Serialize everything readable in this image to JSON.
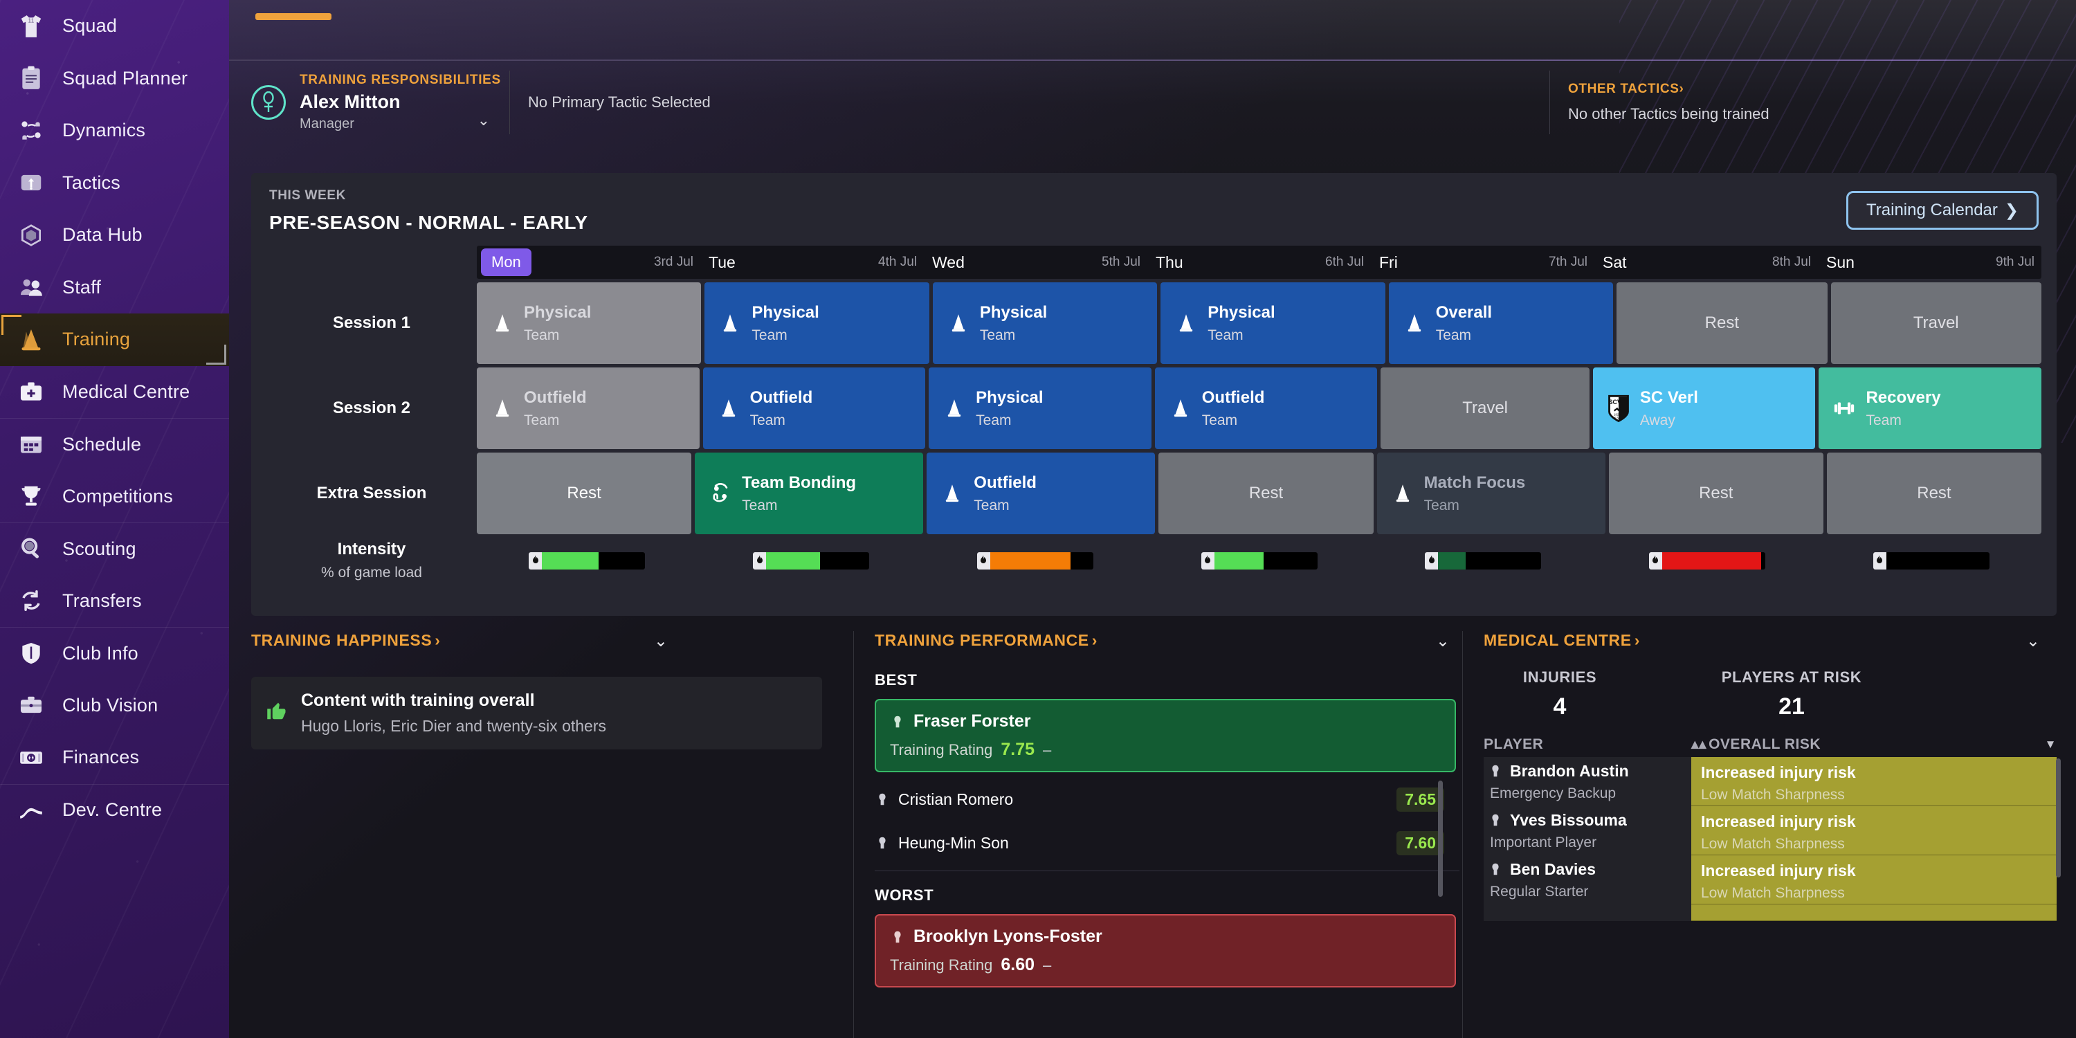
{
  "sidebar": {
    "items": [
      {
        "label": "Squad",
        "icon": "shirt-icon",
        "active": false,
        "sep": false
      },
      {
        "label": "Squad Planner",
        "icon": "clipboard-icon",
        "active": false,
        "sep": false
      },
      {
        "label": "Dynamics",
        "icon": "dynamics-icon",
        "active": false,
        "sep": false
      },
      {
        "label": "Tactics",
        "icon": "tactics-icon",
        "active": false,
        "sep": false
      },
      {
        "label": "Data Hub",
        "icon": "datahub-icon",
        "active": false,
        "sep": false
      },
      {
        "label": "Staff",
        "icon": "staff-icon",
        "active": false,
        "sep": false
      },
      {
        "label": "Training",
        "icon": "cone-icon",
        "active": true,
        "sep": false
      },
      {
        "label": "Medical Centre",
        "icon": "medkit-icon",
        "active": false,
        "sep": false
      },
      {
        "label": "Schedule",
        "icon": "calendar-icon",
        "active": false,
        "sep": true
      },
      {
        "label": "Competitions",
        "icon": "trophy-icon",
        "active": false,
        "sep": false
      },
      {
        "label": "Scouting",
        "icon": "magnifier-icon",
        "active": false,
        "sep": true
      },
      {
        "label": "Transfers",
        "icon": "transfer-arrows-icon",
        "active": false,
        "sep": false
      },
      {
        "label": "Club Info",
        "icon": "shield-icon",
        "active": false,
        "sep": true
      },
      {
        "label": "Club Vision",
        "icon": "briefcase-icon",
        "active": false,
        "sep": false
      },
      {
        "label": "Finances",
        "icon": "banknote-icon",
        "active": false,
        "sep": false
      },
      {
        "label": "Dev. Centre",
        "icon": "growth-curve-icon",
        "active": false,
        "sep": true
      }
    ]
  },
  "responsibilities": {
    "label": "TRAINING RESPONSIBILITIES",
    "name": "Alex Mitton",
    "role": "Manager",
    "primary_tactic": "No Primary Tactic Selected",
    "other_tactics_label": "OTHER TACTICS",
    "other_tactics_value": "No other Tactics being trained"
  },
  "schedule": {
    "week_label": "THIS WEEK",
    "week_title": "PRE-SEASON - NORMAL - EARLY",
    "calendar_button": "Training Calendar",
    "days": [
      {
        "name": "Mon",
        "date": "3rd Jul",
        "today": true
      },
      {
        "name": "Tue",
        "date": "4th Jul",
        "today": false
      },
      {
        "name": "Wed",
        "date": "5th Jul",
        "today": false
      },
      {
        "name": "Thu",
        "date": "6th Jul",
        "today": false
      },
      {
        "name": "Fri",
        "date": "7th Jul",
        "today": false
      },
      {
        "name": "Sat",
        "date": "8th Jul",
        "today": false
      },
      {
        "name": "Sun",
        "date": "9th Jul",
        "today": false
      }
    ],
    "rows": [
      {
        "label": "Session 1",
        "cells": [
          {
            "title": "Physical",
            "sub": "Team",
            "style": "c-grey",
            "icon": "cone-icon",
            "center": false
          },
          {
            "title": "Physical",
            "sub": "Team",
            "style": "c-blue",
            "icon": "cone-icon",
            "center": false
          },
          {
            "title": "Physical",
            "sub": "Team",
            "style": "c-blue",
            "icon": "cone-icon",
            "center": false
          },
          {
            "title": "Physical",
            "sub": "Team",
            "style": "c-blue",
            "icon": "cone-icon",
            "center": false
          },
          {
            "title": "Overall",
            "sub": "Team",
            "style": "c-blue",
            "icon": "cone-icon",
            "center": false
          },
          {
            "title": "Rest",
            "sub": "",
            "style": "c-greym",
            "icon": "none",
            "center": true
          },
          {
            "title": "Travel",
            "sub": "",
            "style": "c-greym",
            "icon": "none",
            "center": true
          }
        ]
      },
      {
        "label": "Session 2",
        "cells": [
          {
            "title": "Outfield",
            "sub": "Team",
            "style": "c-grey",
            "icon": "cone-icon",
            "center": false
          },
          {
            "title": "Outfield",
            "sub": "Team",
            "style": "c-blue",
            "icon": "cone-icon",
            "center": false
          },
          {
            "title": "Physical",
            "sub": "Team",
            "style": "c-blue",
            "icon": "cone-icon",
            "center": false
          },
          {
            "title": "Outfield",
            "sub": "Team",
            "style": "c-blue",
            "icon": "cone-icon",
            "center": false
          },
          {
            "title": "Travel",
            "sub": "",
            "style": "c-greym",
            "icon": "none",
            "center": true
          },
          {
            "title": "SC Verl",
            "sub": "Away",
            "style": "c-cyan",
            "icon": "scv-badge-icon",
            "center": false
          },
          {
            "title": "Recovery",
            "sub": "Team",
            "style": "c-teal",
            "icon": "dumbbell-icon",
            "center": false
          }
        ]
      },
      {
        "label": "Extra Session",
        "cells": [
          {
            "title": "Rest",
            "sub": "",
            "style": "c-greyd",
            "icon": "none",
            "center": true
          },
          {
            "title": "Team Bonding",
            "sub": "Team",
            "style": "c-green",
            "icon": "bonding-icon",
            "center": false
          },
          {
            "title": "Outfield",
            "sub": "Team",
            "style": "c-blue",
            "icon": "cone-icon",
            "center": false
          },
          {
            "title": "Rest",
            "sub": "",
            "style": "c-greym",
            "icon": "none",
            "center": true
          },
          {
            "title": "Match Focus",
            "sub": "Team",
            "style": "c-dark",
            "icon": "cone-icon",
            "center": false
          },
          {
            "title": "Rest",
            "sub": "",
            "style": "c-greym",
            "icon": "none",
            "center": true
          },
          {
            "title": "Rest",
            "sub": "",
            "style": "c-greym",
            "icon": "none",
            "center": true
          }
        ]
      }
    ],
    "intensity": {
      "label_1": "Intensity",
      "label_2": "% of game load",
      "bars": [
        {
          "pct": 55,
          "color": "#55dd55"
        },
        {
          "pct": 52,
          "color": "#55dd55"
        },
        {
          "pct": 78,
          "color": "#f57c06"
        },
        {
          "pct": 48,
          "color": "#55dd55"
        },
        {
          "pct": 27,
          "color": "#17683a"
        },
        {
          "pct": 96,
          "color": "#e31616"
        },
        {
          "pct": 0,
          "color": "#000000"
        }
      ]
    }
  },
  "training_happiness": {
    "title": "TRAINING HAPPINESS",
    "headline": "Content with training overall",
    "detail": "Hugo Lloris, Eric Dier and twenty-six others"
  },
  "training_performance": {
    "title": "TRAINING PERFORMANCE",
    "best_label": "BEST",
    "worst_label": "WORST",
    "rating_label": "Training Rating",
    "best": {
      "name": "Fraser Forster",
      "rating": "7.75",
      "trend": "–"
    },
    "others": [
      {
        "name": "Cristian Romero",
        "rating": "7.65"
      },
      {
        "name": "Heung-Min Son",
        "rating": "7.60"
      }
    ],
    "worst": {
      "name": "Brooklyn Lyons-Foster",
      "rating": "6.60",
      "trend": "–"
    }
  },
  "medical_centre": {
    "title": "MEDICAL CENTRE",
    "stats": [
      {
        "label": "INJURIES",
        "value": "4"
      },
      {
        "label": "PLAYERS AT RISK",
        "value": "21"
      }
    ],
    "columns": {
      "player": "PLAYER",
      "risk": "OVERALL RISK"
    },
    "rows": [
      {
        "name": "Brandon Austin",
        "role": "Emergency Backup",
        "risk": "Increased injury risk",
        "reason": "Low Match Sharpness"
      },
      {
        "name": "Yves Bissouma",
        "role": "Important Player",
        "risk": "Increased injury risk",
        "reason": "Low Match Sharpness"
      },
      {
        "name": "Ben Davies",
        "role": "Regular Starter",
        "risk": "Increased injury risk",
        "reason": "Low Match Sharpness"
      }
    ]
  },
  "colors": {
    "accent_orange": "#efa23c",
    "sidebar_purple": "#3b1a68",
    "session_blue": "#1d54a8",
    "match_cyan": "#4fc0f0",
    "recovery_teal": "#43bc9e",
    "bonding_green": "#0e7d58",
    "risk_olive": "#a5a032"
  }
}
